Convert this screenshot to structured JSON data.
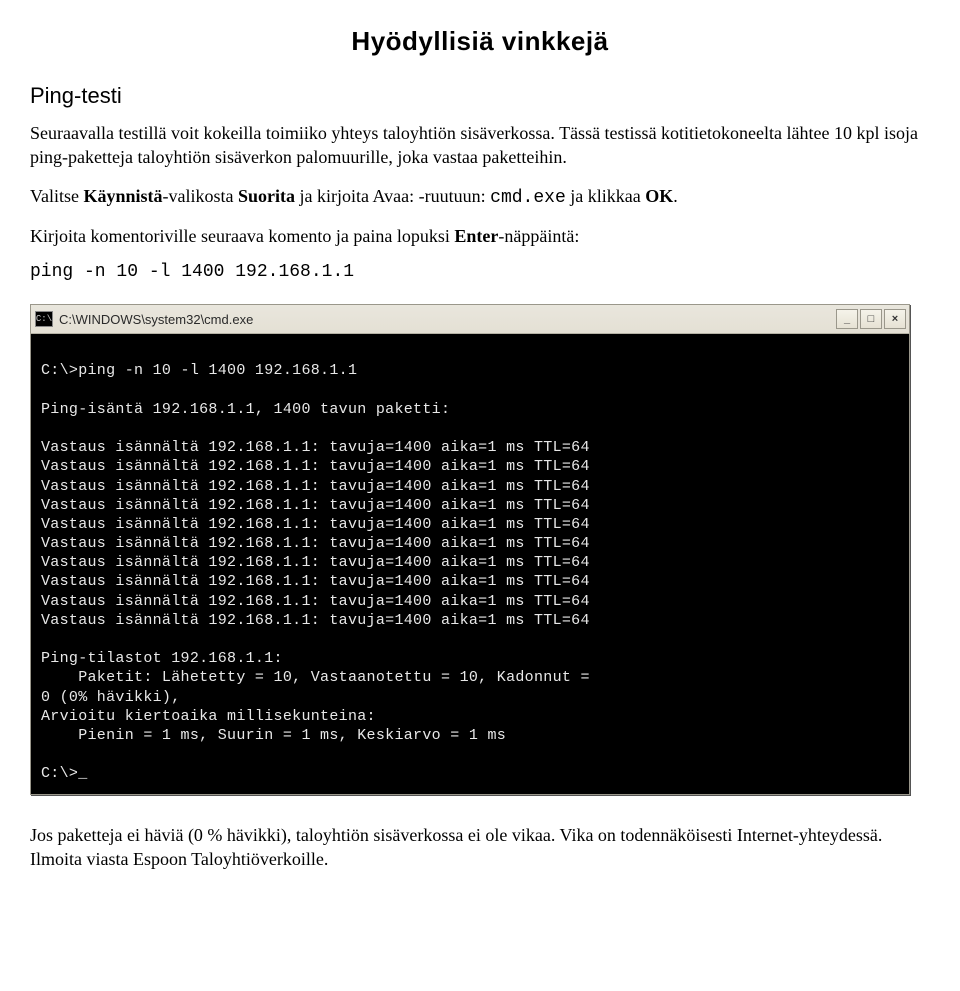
{
  "title": "Hyödyllisiä vinkkejä",
  "section_title": "Ping-testi",
  "intro1": "Seuraavalla testillä voit kokeilla toimiiko yhteys taloyhtiön sisäverkossa. Tässä testissä kotitietokoneelta lähtee 10 kpl isoja ping-paketteja taloyhtiön sisäverkon palomuurille, joka vastaa paketteihin.",
  "instr_pre": "Valitse ",
  "instr_b1": "Käynnistä",
  "instr_mid1": "-valikosta ",
  "instr_b2": "Suorita",
  "instr_mid2": " ja kirjoita Avaa: -ruutuun: ",
  "instr_code": "cmd.exe",
  "instr_mid3": " ja klikkaa ",
  "instr_b3": "OK",
  "instr_end": ".",
  "cmd_intro_pre": "Kirjoita komentoriville seuraava komento ja paina lopuksi ",
  "cmd_intro_b": "Enter",
  "cmd_intro_end": "-näppäintä:",
  "ping_command": "ping -n 10 -l 1400 192.168.1.1",
  "cmd_window": {
    "icon_label": "C:\\",
    "title": "C:\\WINDOWS\\system32\\cmd.exe",
    "btn_min": "_",
    "btn_max": "□",
    "btn_close": "×",
    "lines": [
      "",
      "C:\\>ping -n 10 -l 1400 192.168.1.1",
      "",
      "Ping-isäntä 192.168.1.1, 1400 tavun paketti:",
      "",
      "Vastaus isännältä 192.168.1.1: tavuja=1400 aika=1 ms TTL=64",
      "Vastaus isännältä 192.168.1.1: tavuja=1400 aika=1 ms TTL=64",
      "Vastaus isännältä 192.168.1.1: tavuja=1400 aika=1 ms TTL=64",
      "Vastaus isännältä 192.168.1.1: tavuja=1400 aika=1 ms TTL=64",
      "Vastaus isännältä 192.168.1.1: tavuja=1400 aika=1 ms TTL=64",
      "Vastaus isännältä 192.168.1.1: tavuja=1400 aika=1 ms TTL=64",
      "Vastaus isännältä 192.168.1.1: tavuja=1400 aika=1 ms TTL=64",
      "Vastaus isännältä 192.168.1.1: tavuja=1400 aika=1 ms TTL=64",
      "Vastaus isännältä 192.168.1.1: tavuja=1400 aika=1 ms TTL=64",
      "Vastaus isännältä 192.168.1.1: tavuja=1400 aika=1 ms TTL=64",
      "",
      "Ping-tilastot 192.168.1.1:",
      "    Paketit: Lähetetty = 10, Vastaanotettu = 10, Kadonnut =",
      "0 (0% hävikki),",
      "Arvioitu kiertoaika millisekunteina:",
      "    Pienin = 1 ms, Suurin = 1 ms, Keskiarvo = 1 ms",
      "",
      "C:\\>_"
    ]
  },
  "outro": "Jos paketteja ei häviä (0 % hävikki), taloyhtiön sisäverkossa ei ole vikaa. Vika on todennäköisesti Internet-yhteydessä. Ilmoita viasta Espoon Taloyhtiöverkoille."
}
